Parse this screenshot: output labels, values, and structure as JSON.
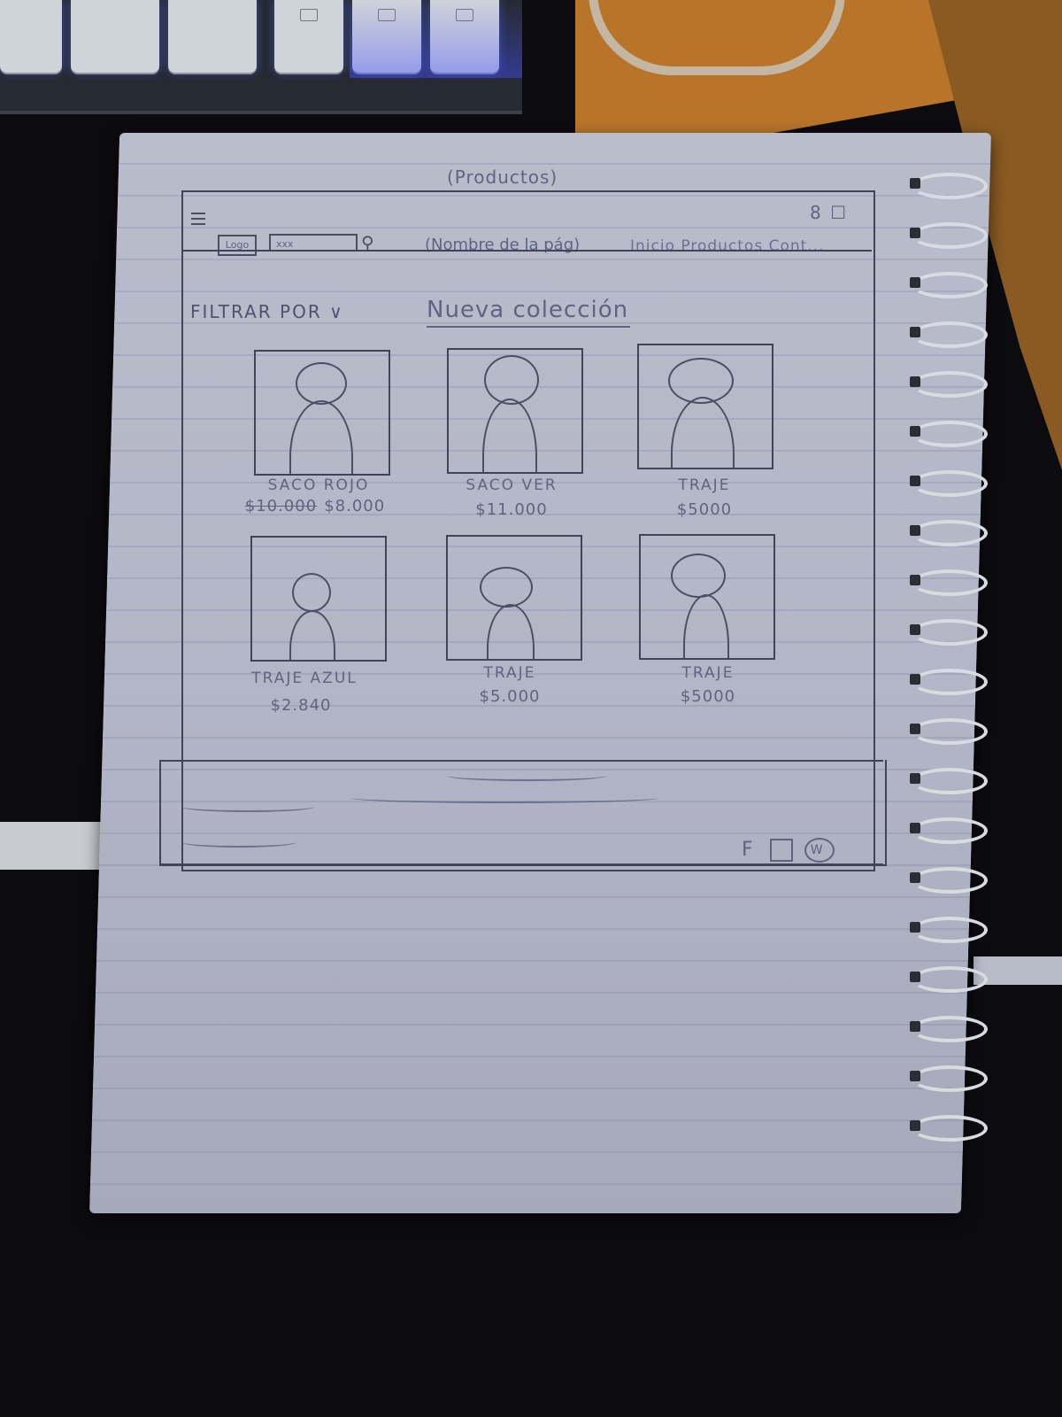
{
  "sketch": {
    "page_title": "(Productos)",
    "top_right_icons": "8 ☐",
    "header": {
      "logo": "Logo",
      "search_placeholder": "xxx",
      "brand_name": "(Nombre de la pág)",
      "nav": "Inicio Productos Cont..."
    },
    "filter_label": "FILTRAR POR ∨",
    "collection_title": "Nueva colección",
    "products": [
      {
        "name": "SACO ROJO",
        "old_price": "$10.000",
        "price": "$8.000"
      },
      {
        "name": "SACO VER",
        "old_price": "",
        "price": "$11.000"
      },
      {
        "name": "TRAJE",
        "old_price": "",
        "price": "$5000"
      },
      {
        "name": "TRAJE AZUL",
        "old_price": "",
        "price": "$2.840"
      },
      {
        "name": "TRAJE",
        "old_price": "",
        "price": "$5.000"
      },
      {
        "name": "TRAJE",
        "old_price": "",
        "price": "$5000"
      }
    ],
    "social": {
      "f": "F",
      "w": "W"
    }
  },
  "colors": {
    "paper": "#b9bccb",
    "ink": "#4a4f63",
    "desk_orange": "#b8752a",
    "background": "#0c0c10"
  }
}
